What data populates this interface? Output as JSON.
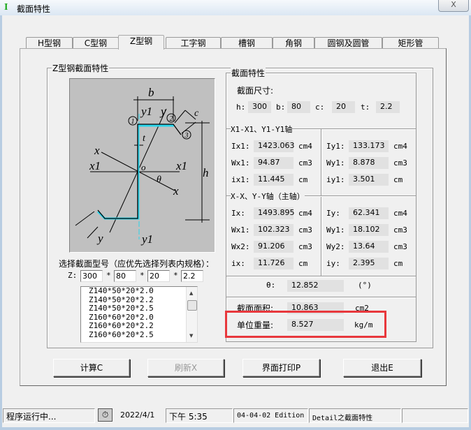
{
  "window": {
    "title": "截面特性",
    "app_icon": "I-beam-icon",
    "close_label": "X"
  },
  "tabs": [
    {
      "label": "H型钢"
    },
    {
      "label": "C型钢"
    },
    {
      "label": "Z型钢",
      "active": true
    },
    {
      "label": "工字钢"
    },
    {
      "label": "槽钢"
    },
    {
      "label": "角钢"
    },
    {
      "label": "圆钢及圆管"
    },
    {
      "label": "矩形管"
    }
  ],
  "left_group": {
    "title": "Z型钢截面特性",
    "diagram_labels": {
      "b": "b",
      "c": "c",
      "t": "t",
      "h": "h",
      "x": "x",
      "y": "y",
      "x1": "x1",
      "y1": "y1",
      "o": "o",
      "theta": "θ",
      "p1": "1",
      "p2": "2",
      "p3": "3"
    },
    "select_label": "选择截面型号（应优先选择列表内规格）：",
    "z_label": "Z:",
    "inputs": [
      "300",
      "80",
      "20",
      "2.2"
    ],
    "sep": "*",
    "list": [
      "Z140*50*20*2.0",
      "Z140*50*20*2.2",
      "Z140*50*20*2.5",
      "Z160*60*20*2.0",
      "Z160*60*20*2.2",
      "Z160*60*20*2.5"
    ]
  },
  "right_group": {
    "title": "截面特性",
    "dims_title": "截面尺寸:",
    "dims": [
      {
        "label": "h:",
        "value": "300"
      },
      {
        "label": "b:",
        "value": "80"
      },
      {
        "label": "c:",
        "value": "20"
      },
      {
        "label": "t:",
        "value": "2.2"
      }
    ],
    "axis1_title": "X1-X1、Y1-Y1轴",
    "axis1_left": [
      {
        "label": "Ix1:",
        "value": "1423.063",
        "unit": "cm4"
      },
      {
        "label": "Wx1:",
        "value": "94.87",
        "unit": "cm3"
      },
      {
        "label": "ix1:",
        "value": "11.445",
        "unit": "cm"
      }
    ],
    "axis1_right": [
      {
        "label": "Iy1:",
        "value": "133.173",
        "unit": "cm4"
      },
      {
        "label": "Wy1:",
        "value": "8.878",
        "unit": "cm3"
      },
      {
        "label": "iy1:",
        "value": "3.501",
        "unit": "cm"
      }
    ],
    "axis2_title": "X-X、Y-Y轴（主轴）",
    "axis2_left": [
      {
        "label": "Ix:",
        "value": "1493.895",
        "unit": "cm4"
      },
      {
        "label": "Wx1:",
        "value": "102.323",
        "unit": "cm3"
      },
      {
        "label": "Wx2:",
        "value": "91.206",
        "unit": "cm3"
      },
      {
        "label": "ix:",
        "value": "11.726",
        "unit": "cm"
      }
    ],
    "axis2_right": [
      {
        "label": "Iy:",
        "value": "62.341",
        "unit": "cm4"
      },
      {
        "label": "Wy1:",
        "value": "18.102",
        "unit": "cm3"
      },
      {
        "label": "Wy2:",
        "value": "13.64",
        "unit": "cm3"
      },
      {
        "label": "iy:",
        "value": "2.395",
        "unit": "cm"
      }
    ],
    "theta": {
      "label": "θ:",
      "value": "12.852",
      "unit": "(°)"
    },
    "area": {
      "label": "截面面积:",
      "value": "10.863",
      "unit": "cm2"
    },
    "weight": {
      "label": "单位重量:",
      "value": "8.527",
      "unit": "kg/m"
    },
    "highlight_color": "#e8383d"
  },
  "buttons": {
    "calc": "计算C",
    "refresh": "刷新X",
    "print": "界面打印P",
    "exit": "退出E"
  },
  "status": {
    "state": "程序运行中...",
    "icon": "stopwatch-icon",
    "date": "2022/4/1",
    "time": "下午 5:35",
    "edition": "04-04-02 Edition",
    "detail": "Detail之截面特性",
    "extra": ""
  }
}
